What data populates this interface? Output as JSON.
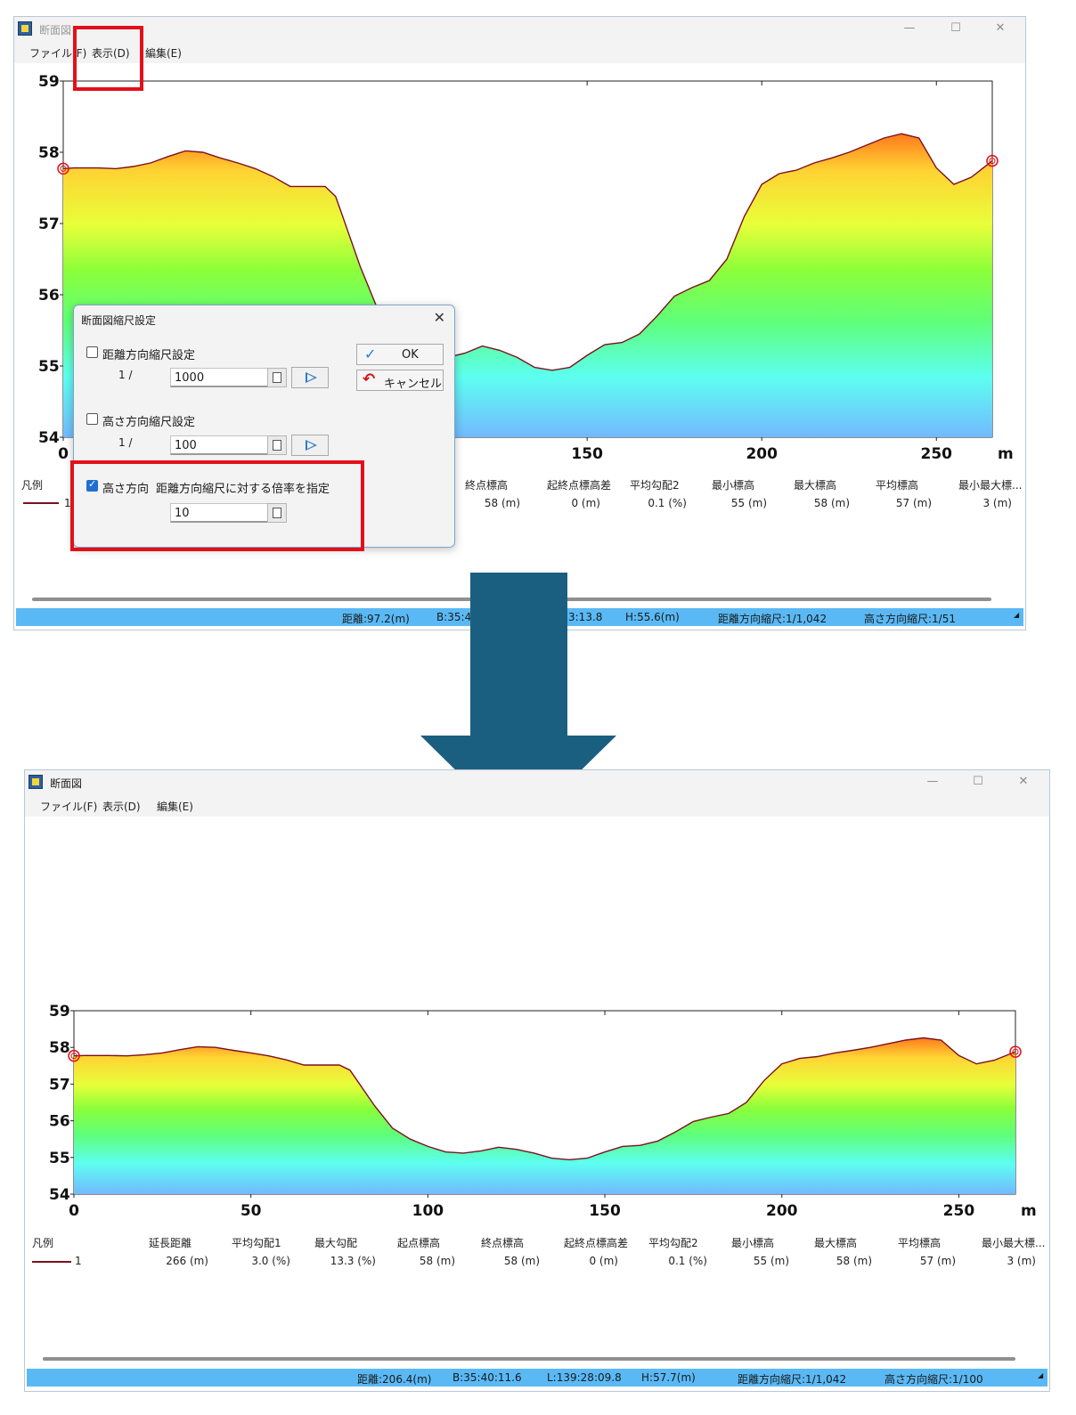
{
  "app": {
    "title": "断面図",
    "menu": [
      "ファイル(F)",
      "表示(D)",
      "編集(E)"
    ],
    "window_controls": [
      "—",
      "☐",
      "✕"
    ]
  },
  "top": {
    "chart_data": {
      "type": "area",
      "x": [
        0,
        3,
        10,
        15,
        20,
        25,
        30,
        35,
        40,
        45,
        50,
        55,
        60,
        65,
        70,
        75,
        78,
        80,
        85,
        90,
        95,
        100,
        105,
        110,
        115,
        120,
        125,
        130,
        135,
        140,
        145,
        150,
        155,
        160,
        165,
        170,
        175,
        180,
        185,
        190,
        195,
        200,
        205,
        210,
        215,
        220,
        225,
        230,
        235,
        240,
        245,
        250,
        255,
        260,
        266
      ],
      "values": [
        57.77,
        57.78,
        57.78,
        57.77,
        57.8,
        57.85,
        57.94,
        58.02,
        58.0,
        57.92,
        57.85,
        57.77,
        57.66,
        57.52,
        57.52,
        57.52,
        57.38,
        57.1,
        56.4,
        55.8,
        55.5,
        55.3,
        55.15,
        55.12,
        55.18,
        55.28,
        55.22,
        55.12,
        54.98,
        54.94,
        54.98,
        55.15,
        55.3,
        55.33,
        55.45,
        55.7,
        55.98,
        56.1,
        56.2,
        56.5,
        57.1,
        57.55,
        57.7,
        57.75,
        57.85,
        57.92,
        58.0,
        58.1,
        58.2,
        58.26,
        58.2,
        57.78,
        57.55,
        57.65,
        57.88
      ],
      "xlim": [
        0,
        266
      ],
      "ylim": [
        54,
        59
      ],
      "xticks": [
        "0",
        "150",
        "200",
        "250"
      ],
      "yticks": [
        "54",
        "55",
        "56",
        "57",
        "58",
        "59"
      ],
      "xunit": "m"
    },
    "stats_headers": [
      "凡例",
      "終点標高",
      "起終点標高差",
      "平均勾配2",
      "最小標高",
      "最大標高",
      "平均標高",
      "最小最大標..."
    ],
    "stats_values": [
      "1",
      "58 (m)",
      "0 (m)",
      "0.1 (%)",
      "55 (m)",
      "58 (m)",
      "57 (m)",
      "3 (m)"
    ],
    "status": [
      "距離:97.2(m)",
      "B:35:40",
      "3:13.8",
      "H:55.6(m)",
      "距離方向縮尺:1/1,042",
      "高さ方向縮尺:1/51"
    ]
  },
  "dialog": {
    "title": "断面図縮尺設定",
    "close": "✕",
    "distance_label": "距離方向縮尺設定",
    "distance_prefix": "1 /",
    "distance_value": "1000",
    "height_label": "高さ方向縮尺設定",
    "height_prefix": "1 /",
    "height_value": "100",
    "ratio_label_a": "高さ方向",
    "ratio_label_b": "距離方向縮尺に対する倍率を指定",
    "ratio_value": "10",
    "ok_label": "OK",
    "cancel_label": "キャンセル",
    "ratio_checked": true
  },
  "bottom": {
    "chart_data": {
      "type": "area",
      "x": [
        0,
        3,
        10,
        15,
        20,
        25,
        30,
        35,
        40,
        45,
        50,
        55,
        60,
        65,
        70,
        75,
        78,
        80,
        85,
        90,
        95,
        100,
        105,
        110,
        115,
        120,
        125,
        130,
        135,
        140,
        145,
        150,
        155,
        160,
        165,
        170,
        175,
        180,
        185,
        190,
        195,
        200,
        205,
        210,
        215,
        220,
        225,
        230,
        235,
        240,
        245,
        250,
        255,
        260,
        266
      ],
      "values": [
        57.77,
        57.78,
        57.78,
        57.77,
        57.8,
        57.85,
        57.94,
        58.02,
        58.0,
        57.92,
        57.85,
        57.77,
        57.66,
        57.52,
        57.52,
        57.52,
        57.38,
        57.1,
        56.4,
        55.8,
        55.5,
        55.3,
        55.15,
        55.12,
        55.18,
        55.28,
        55.22,
        55.12,
        54.98,
        54.94,
        54.98,
        55.15,
        55.3,
        55.33,
        55.45,
        55.7,
        55.98,
        56.1,
        56.2,
        56.5,
        57.1,
        57.55,
        57.7,
        57.75,
        57.85,
        57.92,
        58.0,
        58.1,
        58.2,
        58.26,
        58.2,
        57.78,
        57.55,
        57.65,
        57.88
      ],
      "xlim": [
        0,
        266
      ],
      "ylim": [
        54,
        59
      ],
      "xticks": [
        "0",
        "50",
        "100",
        "150",
        "200",
        "250"
      ],
      "yticks": [
        "54",
        "55",
        "56",
        "57",
        "58",
        "59"
      ],
      "xunit": "m"
    },
    "stats_headers": [
      "凡例",
      "延長距離",
      "平均勾配1",
      "最大勾配",
      "起点標高",
      "終点標高",
      "起終点標高差",
      "平均勾配2",
      "最小標高",
      "最大標高",
      "平均標高",
      "最小最大標..."
    ],
    "stats_values": [
      "1",
      "266 (m)",
      "3.0 (%)",
      "13.3 (%)",
      "58 (m)",
      "58 (m)",
      "0 (m)",
      "0.1 (%)",
      "55 (m)",
      "58 (m)",
      "57 (m)",
      "3 (m)"
    ],
    "status": [
      "距離:206.4(m)",
      "B:35:40:11.6",
      "L:139:28:09.8",
      "H:57.7(m)",
      "距離方向縮尺:1/1,042",
      "高さ方向縮尺:1/100"
    ]
  },
  "colors": {
    "profile_line": "#7a1020",
    "highlight": "#e3101a",
    "arrow": "#1b5f80",
    "status_bar": "#5ab9f5"
  }
}
